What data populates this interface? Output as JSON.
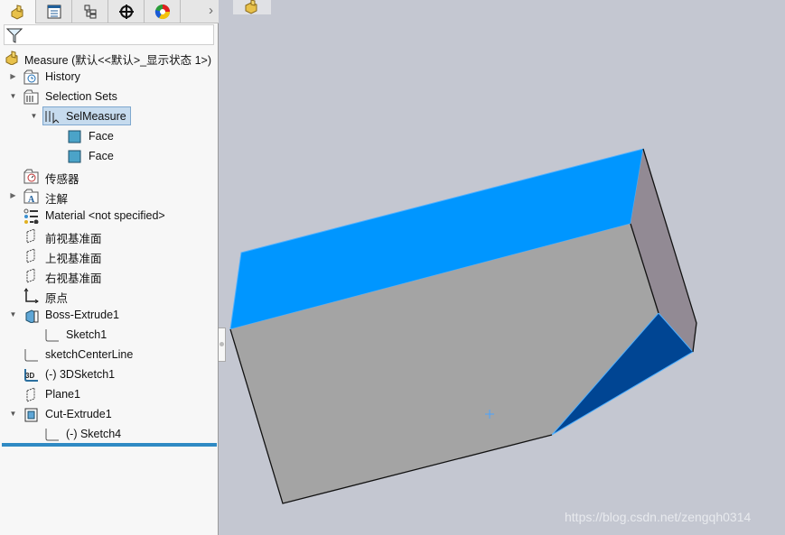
{
  "panel_tabs": [
    {
      "icon": "feature-manager-icon",
      "active": true
    },
    {
      "icon": "property-manager-icon",
      "active": false
    },
    {
      "icon": "configuration-manager-icon",
      "active": false
    },
    {
      "icon": "dimxpert-icon",
      "active": false
    },
    {
      "icon": "display-manager-icon",
      "active": false
    }
  ],
  "panel_more_arrow": "›",
  "filter": {
    "icon": "filter-icon",
    "value": ""
  },
  "root": {
    "label": "Measure  (默认<<默认>_显示状态 1>)"
  },
  "tree": [
    {
      "label": "History",
      "icon": "history-folder-icon",
      "expander": "collapsed"
    },
    {
      "label": "Selection Sets",
      "icon": "selection-sets-folder-icon",
      "expander": "expanded"
    },
    {
      "label": "SelMeasure",
      "icon": "selection-set-icon",
      "expander": "expanded",
      "selected": true
    },
    {
      "label": "Face",
      "icon": "face-icon"
    },
    {
      "label": "Face",
      "icon": "face-icon"
    },
    {
      "label": "传感器",
      "icon": "sensors-folder-icon"
    },
    {
      "label": "注解",
      "icon": "annotations-folder-icon",
      "expander": "collapsed"
    },
    {
      "label": "Material <not specified>",
      "icon": "material-icon"
    },
    {
      "label": "前视基准面",
      "icon": "plane-icon"
    },
    {
      "label": "上视基准面",
      "icon": "plane-icon"
    },
    {
      "label": "右视基准面",
      "icon": "plane-icon"
    },
    {
      "label": "原点",
      "icon": "origin-icon"
    },
    {
      "label": "Boss-Extrude1",
      "icon": "boss-extrude-icon",
      "expander": "expanded"
    },
    {
      "label": "Sketch1",
      "icon": "sketch-icon"
    },
    {
      "label": "sketchCenterLine",
      "icon": "sketch-icon"
    },
    {
      "label": "(-) 3DSketch1",
      "icon": "3d-sketch-icon"
    },
    {
      "label": "Plane1",
      "icon": "plane-icon"
    },
    {
      "label": "Cut-Extrude1",
      "icon": "cut-extrude-icon",
      "expander": "expanded"
    },
    {
      "label": "(-) Sketch4",
      "icon": "sketch-icon"
    }
  ],
  "viewport": {
    "background": "#c4c7d1",
    "colors": {
      "selected_face": "#0096ff",
      "front_face": "#a4a4a4",
      "side_face": "#928a94",
      "cut_face": "#004593",
      "edge_highlight": "#4fb0ff"
    },
    "watermark": "https://blog.csdn.net/zengqh0314"
  }
}
